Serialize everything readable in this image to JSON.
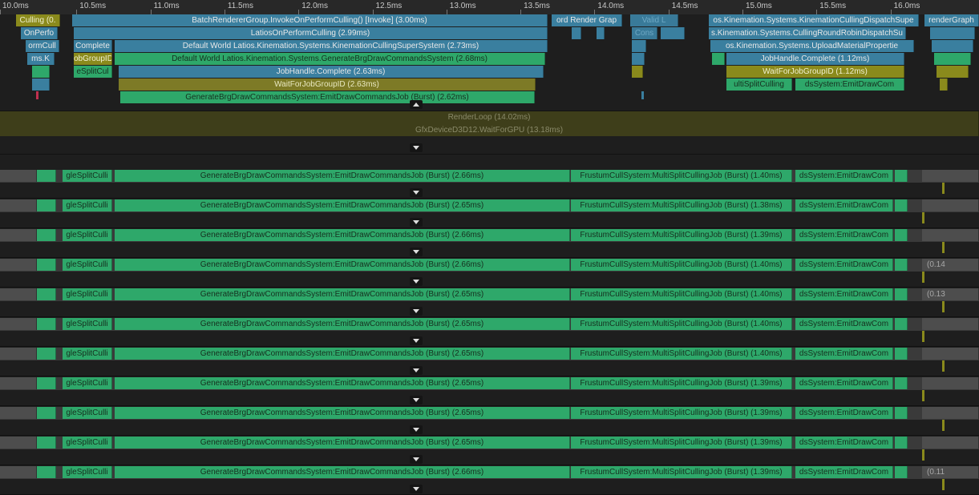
{
  "ruler": {
    "ticks": [
      "10.0ms",
      "10.5ms",
      "11.0ms",
      "11.5ms",
      "12.0ms",
      "12.5ms",
      "13.0ms",
      "13.5ms",
      "14.0ms",
      "14.5ms",
      "15.0ms",
      "15.5ms",
      "16.0ms"
    ]
  },
  "main_thread": {
    "row1": {
      "culling": "Culling (0.",
      "batch": "BatchRendererGroup.InvokeOnPerformCulling() [Invoke] (3.00ms)",
      "render_graph": "ord Render Grap",
      "valid": "Valid L",
      "kinemation_dispatch": "os.Kinemation.Systems.KinemationCullingDispatchSupe",
      "render_graph2": "renderGraph"
    },
    "row2": {
      "onperf": "OnPerfo",
      "latios_cull": "LatiosOnPerformCulling (2.99ms)",
      "cons": "Cons",
      "roundrobin": "s.Kinemation.Systems.CullingRoundRobinDispatchSu"
    },
    "row3": {
      "ormcull": "ormCull",
      "complete": "Complete",
      "super": "Default World Latios.Kinemation.Systems.KinemationCullingSuperSystem (2.73ms)",
      "upload": "os.Kinemation.Systems.UploadMaterialPropertie"
    },
    "row4": {
      "msk": "ms.K",
      "jobgroup": "obGroupID",
      "generate": "Default World Latios.Kinemation.Systems.GenerateBrgDrawCommandsSystem (2.68ms)",
      "jobhandle_small": "JobHandle.Complete (1.12ms)"
    },
    "row5": {
      "split": "eSplitCul",
      "jobhandle": "JobHandle.Complete (2.63ms)",
      "waitfor_small": "WaitForJobGroupID (1.12ms)"
    },
    "row6": {
      "waitfor": "WaitForJobGroupID (2.63ms)",
      "multisplit_small": "ultiSplitCulling",
      "ds_small": "dsSystem:EmitDrawCom"
    },
    "row7": {
      "emit": "GenerateBrgDrawCommandsSystem:EmitDrawCommandsJob (Burst) (2.62ms)"
    }
  },
  "render_thread": {
    "renderloop": "RenderLoop (14.02ms)",
    "gfx": "GfxDeviceD3D12.WaitForGPU (13.18ms)"
  },
  "workers": [
    {
      "split": "gleSplitCulli",
      "emit": "GenerateBrgDrawCommandsSystem:EmitDrawCommandsJob (Burst) (2.66ms)",
      "frustum": "FrustumCullSystem:MultiSplitCullingJob (Burst) (1.40ms)",
      "ds": "dsSystem:EmitDrawCom",
      "tail": ""
    },
    {
      "split": "gleSplitCulli",
      "emit": "GenerateBrgDrawCommandsSystem:EmitDrawCommandsJob (Burst) (2.65ms)",
      "frustum": "FrustumCullSystem:MultiSplitCullingJob (Burst) (1.38ms)",
      "ds": "dsSystem:EmitDrawCom",
      "tail": ""
    },
    {
      "split": "gleSplitCulli",
      "emit": "GenerateBrgDrawCommandsSystem:EmitDrawCommandsJob (Burst) (2.66ms)",
      "frustum": "FrustumCullSystem:MultiSplitCullingJob (Burst) (1.39ms)",
      "ds": "dsSystem:EmitDrawCom",
      "tail": ""
    },
    {
      "split": "gleSplitCulli",
      "emit": "GenerateBrgDrawCommandsSystem:EmitDrawCommandsJob (Burst) (2.66ms)",
      "frustum": "FrustumCullSystem:MultiSplitCullingJob (Burst) (1.40ms)",
      "ds": "dsSystem:EmitDrawCom",
      "tail": "(0.14"
    },
    {
      "split": "gleSplitCulli",
      "emit": "GenerateBrgDrawCommandsSystem:EmitDrawCommandsJob (Burst) (2.65ms)",
      "frustum": "FrustumCullSystem:MultiSplitCullingJob (Burst) (1.40ms)",
      "ds": "dsSystem:EmitDrawCom",
      "tail": "(0.13"
    },
    {
      "split": "gleSplitCulli",
      "emit": "GenerateBrgDrawCommandsSystem:EmitDrawCommandsJob (Burst) (2.65ms)",
      "frustum": "FrustumCullSystem:MultiSplitCullingJob (Burst) (1.40ms)",
      "ds": "dsSystem:EmitDrawCom",
      "tail": ""
    },
    {
      "split": "gleSplitCulli",
      "emit": "GenerateBrgDrawCommandsSystem:EmitDrawCommandsJob (Burst) (2.65ms)",
      "frustum": "FrustumCullSystem:MultiSplitCullingJob (Burst) (1.40ms)",
      "ds": "dsSystem:EmitDrawCom",
      "tail": ""
    },
    {
      "split": "gleSplitCulli",
      "emit": "GenerateBrgDrawCommandsSystem:EmitDrawCommandsJob (Burst) (2.65ms)",
      "frustum": "FrustumCullSystem:MultiSplitCullingJob (Burst) (1.39ms)",
      "ds": "dsSystem:EmitDrawCom",
      "tail": ""
    },
    {
      "split": "gleSplitCulli",
      "emit": "GenerateBrgDrawCommandsSystem:EmitDrawCommandsJob (Burst) (2.65ms)",
      "frustum": "FrustumCullSystem:MultiSplitCullingJob (Burst) (1.39ms)",
      "ds": "dsSystem:EmitDrawCom",
      "tail": ""
    },
    {
      "split": "gleSplitCulli",
      "emit": "GenerateBrgDrawCommandsSystem:EmitDrawCommandsJob (Burst) (2.65ms)",
      "frustum": "FrustumCullSystem:MultiSplitCullingJob (Burst) (1.39ms)",
      "ds": "dsSystem:EmitDrawCom",
      "tail": ""
    },
    {
      "split": "gleSplitCulli",
      "emit": "GenerateBrgDrawCommandsSystem:EmitDrawCommandsJob (Burst) (2.66ms)",
      "frustum": "FrustumCullSystem:MultiSplitCullingJob (Burst) (1.39ms)",
      "ds": "dsSystem:EmitDrawCom",
      "tail": "(0.11"
    }
  ],
  "colors": {
    "blue": "#3a7f9f",
    "green": "#2ea86a",
    "olive": "#8a8a1c",
    "background": "#1e1e1e"
  }
}
